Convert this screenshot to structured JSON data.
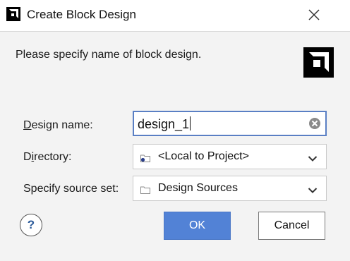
{
  "window": {
    "title": "Create Block Design",
    "app_icon": "amd-logo-icon",
    "close_icon": "close-icon"
  },
  "description": "Please specify name of block design.",
  "logo": "amd-logo-icon",
  "form": {
    "design_name": {
      "label_mnemonic": "D",
      "label_rest": "esign name:",
      "value": "design_1"
    },
    "directory": {
      "label_pre": "D",
      "label_mnemonic": "i",
      "label_rest": "rectory:",
      "value": "<Local to Project>",
      "icon": "folder-icon"
    },
    "source_set": {
      "label": "Specify source set:",
      "value": "Design Sources",
      "icon": "folder-icon"
    }
  },
  "buttons": {
    "help": "?",
    "ok": "OK",
    "cancel": "Cancel"
  },
  "colors": {
    "primary_button": "#5282d6",
    "focus_border": "#5a7fc4"
  }
}
